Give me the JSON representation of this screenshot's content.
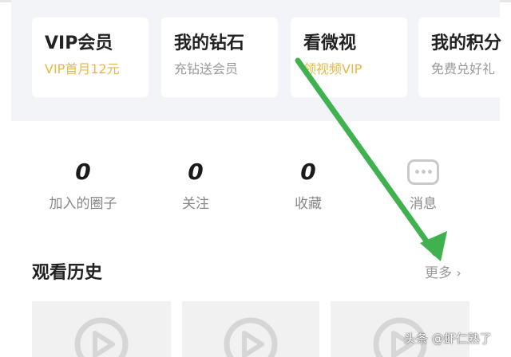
{
  "cards": [
    {
      "title": "VIP会员",
      "subtitle": "VIP首月12元"
    },
    {
      "title": "我的钻石",
      "subtitle": "充钻送会员"
    },
    {
      "title": "看微视",
      "subtitle": "领视频VIP"
    },
    {
      "title": "我的积分",
      "subtitle": "免费兑好礼"
    }
  ],
  "stats": [
    {
      "value": "0",
      "label": "加入的圈子"
    },
    {
      "value": "0",
      "label": "关注"
    },
    {
      "value": "0",
      "label": "收藏"
    },
    {
      "label": "消息",
      "icon": "chat-bubble-icon"
    }
  ],
  "history": {
    "title": "观看历史",
    "more_label": "更多"
  },
  "watermark": "头条 @虾仁熟了",
  "colors": {
    "accent_gold": "#e8b84a",
    "annotation_arrow": "#3fb24f",
    "band_bg": "#f3f4f8"
  }
}
